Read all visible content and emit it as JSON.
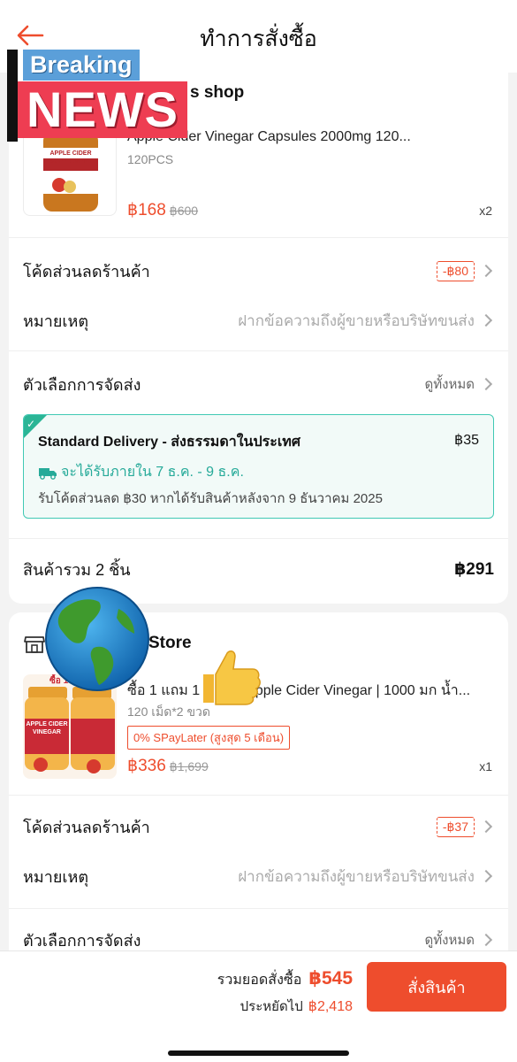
{
  "header": {
    "title": "ทำการสั่งซื้อ"
  },
  "sticker": {
    "line1": "Breaking",
    "line2": "NEWS"
  },
  "shops": [
    {
      "shop_name": "s shop",
      "product": {
        "name": "Apple Cider Vinegar Capsules 2000mg 120...",
        "variation": "120PCS",
        "price": "฿168",
        "old_price": "฿600",
        "qty": "x2",
        "image_label1": "APPLE CIDER",
        "image_label2": "SUPPLEMENT"
      },
      "voucher": {
        "label": "โค้ดส่วนลดร้านค้า",
        "value": "-฿80"
      },
      "note": {
        "label": "หมายเหตุ",
        "placeholder": "ฝากข้อความถึงผู้ขายหรือบริษัทขนส่ง"
      },
      "shipping": {
        "label": "ตัวเลือกการจัดส่ง",
        "link": "ดูทั้งหมด",
        "method": "Standard Delivery - ส่งธรรมดาในประเทศ",
        "fee": "฿35",
        "eta": "จะได้รับภายใน 7 ธ.ค. - 9 ธ.ค.",
        "note": "รับโค้ดส่วนลด ฿30 หากได้รับสินค้าหลังจาก 9 ธันวาคม 2025"
      },
      "subtotal": {
        "label": "สินค้ารวม 2 ชิ้น",
        "value": "฿291"
      }
    },
    {
      "shop_name": "Store",
      "product": {
        "name_prefix": "ซื้อ 1 แถม 1",
        "name": "Apple Cider Vinegar | 1000 มก น้ำ...",
        "variation": "120 เม็ด*2 ขวด",
        "badge": "0% SPayLater (สูงสุด 5 เดือน)",
        "price": "฿336",
        "old_price": "฿1,699",
        "qty": "x1",
        "image_label1": "APPLE CIDER",
        "image_label2": "VINEGAR",
        "image_tag": "ซื้อ 1"
      },
      "voucher": {
        "label": "โค้ดส่วนลดร้านค้า",
        "value": "-฿37"
      },
      "note": {
        "label": "หมายเหตุ",
        "placeholder": "ฝากข้อความถึงผู้ขายหรือบริษัทขนส่ง"
      },
      "shipping": {
        "label": "ตัวเลือกการจัดส่ง",
        "link": "ดูทั้งหมด"
      }
    }
  ],
  "footer": {
    "total_label": "รวมยอดสั่งซื้อ",
    "total_value": "฿545",
    "saved_label": "ประหยัดไป",
    "saved_value": "฿2,418",
    "order_button": "สั่งสินค้า"
  },
  "colors": {
    "accent": "#ee4d2d",
    "teal": "#26aa99",
    "background": "#f3f3f3"
  },
  "icons": [
    "back-arrow-icon",
    "store-icon",
    "chevron-right-icon",
    "truck-icon",
    "check-icon",
    "globe-sticker",
    "thumbs-up-sticker"
  ]
}
